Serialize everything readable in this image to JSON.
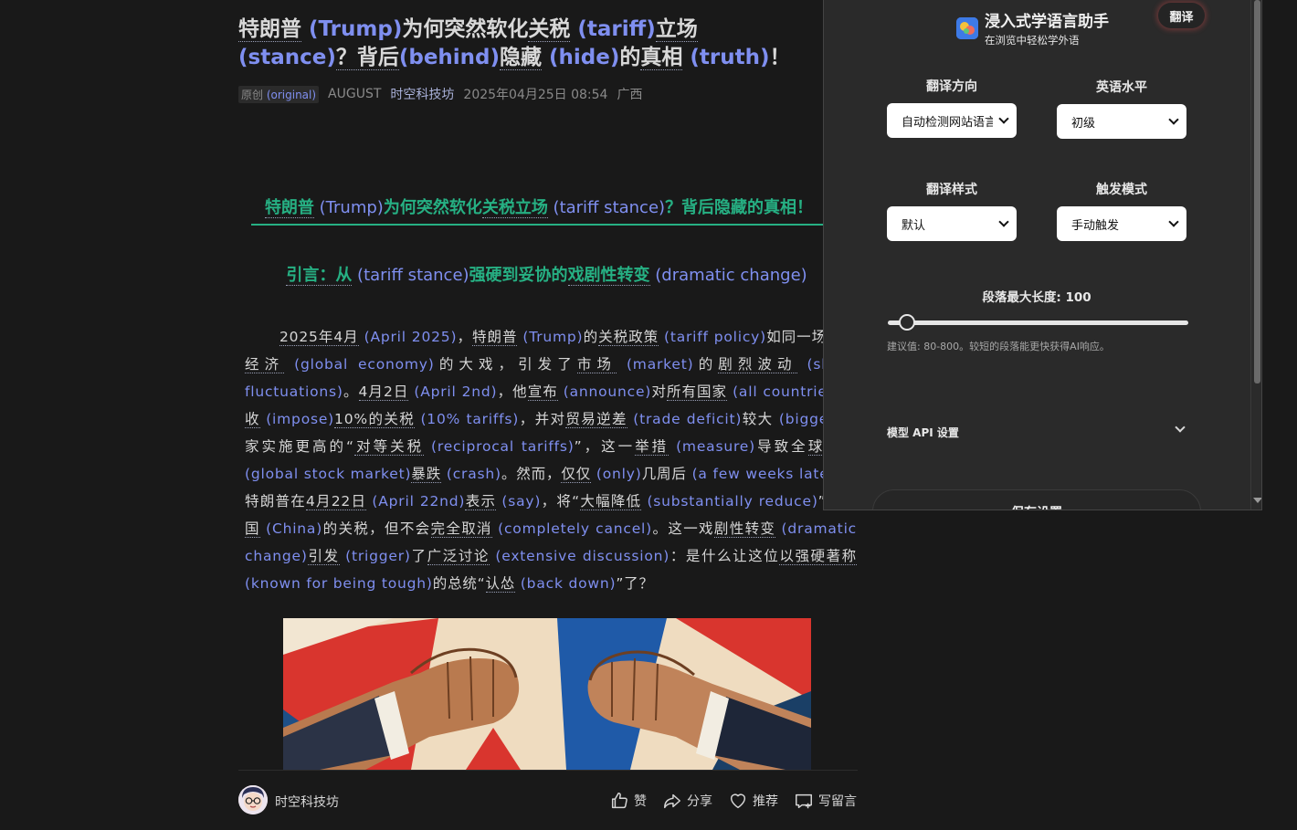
{
  "article": {
    "title": [
      {
        "t": "特朗普",
        "ul": true
      },
      {
        "t": " (Trump)",
        "en": true
      },
      {
        "t": "为何突然软化"
      },
      {
        "t": "关税",
        "ul": true
      },
      {
        "t": " (tariff)",
        "en": true
      },
      {
        "t": "立场",
        "ul": true
      },
      {
        "t": " (stance)",
        "en": true
      },
      {
        "t": "？背后",
        "ul": true
      },
      {
        "t": "(behind)",
        "en": true
      },
      {
        "t": "隐藏",
        "ul": true
      },
      {
        "t": " (hide)",
        "en": true
      },
      {
        "t": "的"
      },
      {
        "t": "真相",
        "ul": true
      },
      {
        "t": " (truth)",
        "en": true
      },
      {
        "t": "！"
      }
    ],
    "meta": {
      "tag_cn": "原创",
      "tag_en": " (original)",
      "author_tag": "AUGUST",
      "account": "时空科技坊",
      "datetime": "2025年04月25日 08:54",
      "location": "广西"
    },
    "heading1": [
      {
        "t": "特朗普",
        "ul": true
      },
      {
        "t": " (Trump)",
        "en": true
      },
      {
        "t": "为何突然软化"
      },
      {
        "t": "关税立场",
        "ul": true
      },
      {
        "t": " (tariff stance)",
        "en": true
      },
      {
        "t": "？背后隐藏的真相！"
      }
    ],
    "heading2": [
      {
        "t": "引言：从",
        "ul": true
      },
      {
        "t": " (tariff stance)",
        "en": true
      },
      {
        "t": "强硬到妥协的"
      },
      {
        "t": "戏剧性转变",
        "ul": true
      },
      {
        "t": " (dramatic change)",
        "en": true
      }
    ],
    "paragraph": [
      {
        "t": "2025年4月",
        "ul": true
      },
      {
        "t": " (April 2025)",
        "en": true
      },
      {
        "t": "，"
      },
      {
        "t": "特朗普",
        "ul": true
      },
      {
        "t": " (Trump)",
        "en": true
      },
      {
        "t": "的"
      },
      {
        "t": "关税政策",
        "ul": true
      },
      {
        "t": " (tariff policy)",
        "en": true
      },
      {
        "t": "如同一场全"
      },
      {
        "t": "球经济",
        "ul": true
      },
      {
        "t": " (global economy)",
        "en": true
      },
      {
        "t": "的大戏，引发了"
      },
      {
        "t": "市场",
        "ul": true
      },
      {
        "t": " (market)",
        "en": true
      },
      {
        "t": "的"
      },
      {
        "t": "剧烈波动",
        "ul": true
      },
      {
        "t": " (sharp fluctuations)",
        "en": true
      },
      {
        "t": "。"
      },
      {
        "t": "4月2日",
        "ul": true
      },
      {
        "t": " (April 2nd)",
        "en": true
      },
      {
        "t": "，他"
      },
      {
        "t": "宣布",
        "ul": true
      },
      {
        "t": " (announce)",
        "en": true
      },
      {
        "t": "对"
      },
      {
        "t": "所有国家",
        "ul": true
      },
      {
        "t": " (all countries)",
        "en": true
      },
      {
        "t": "征收",
        "ul": true
      },
      {
        "t": " (impose)",
        "en": true
      },
      {
        "t": "10%的关税",
        "ul": true
      },
      {
        "t": " (10% tariffs)",
        "en": true
      },
      {
        "t": "，并对"
      },
      {
        "t": "贸易逆差",
        "ul": true
      },
      {
        "t": " (trade deficit)",
        "en": true
      },
      {
        "t": "较大"
      },
      {
        "t": " (bigger)",
        "en": true
      },
      {
        "t": "国家实施更高的“"
      },
      {
        "t": "对等关税",
        "ul": true
      },
      {
        "t": " (reciprocal tariffs)",
        "en": true
      },
      {
        "t": "”，这一"
      },
      {
        "t": "举措",
        "ul": true
      },
      {
        "t": " (measure)",
        "en": true
      },
      {
        "t": "导致全"
      },
      {
        "t": "球股市",
        "ul": true
      },
      {
        "t": " (global stock market)",
        "en": true
      },
      {
        "t": "暴跌",
        "ul": true
      },
      {
        "t": " (crash)",
        "en": true
      },
      {
        "t": "。然而，"
      },
      {
        "t": "仅仅",
        "ul": true
      },
      {
        "t": " (only)",
        "en": true
      },
      {
        "t": "几周后"
      },
      {
        "t": " (a few weeks later)",
        "en": true
      },
      {
        "t": "，特朗普在"
      },
      {
        "t": "4月22日",
        "ul": true
      },
      {
        "t": " (April 22nd)",
        "en": true
      },
      {
        "t": "表示",
        "ul": true
      },
      {
        "t": " (say)",
        "en": true
      },
      {
        "t": "，将“"
      },
      {
        "t": "大幅降低",
        "ul": true
      },
      {
        "t": " (substantially reduce)",
        "en": true
      },
      {
        "t": "”对"
      },
      {
        "t": "中国",
        "ul": true
      },
      {
        "t": " (China)",
        "en": true
      },
      {
        "t": "的关税，但不会"
      },
      {
        "t": "完全取消",
        "ul": true
      },
      {
        "t": " (completely cancel)",
        "en": true
      },
      {
        "t": "。这一戏"
      },
      {
        "t": "剧性转变",
        "ul": true
      },
      {
        "t": " (dramatic change)",
        "en": true
      },
      {
        "t": "引发",
        "ul": true
      },
      {
        "t": " (trigger)",
        "en": true
      },
      {
        "t": "了"
      },
      {
        "t": "广泛讨论",
        "ul": true
      },
      {
        "t": " (extensive discussion)",
        "en": true
      },
      {
        "t": "：是什么让这位"
      },
      {
        "t": "以强硬著称",
        "ul": true
      },
      {
        "t": " (known for being tough)",
        "en": true
      },
      {
        "t": "的总统“"
      },
      {
        "t": "认怂",
        "ul": true
      },
      {
        "t": " (back down)",
        "en": true
      },
      {
        "t": "”了？"
      }
    ]
  },
  "footer": {
    "author": "时空科技坊",
    "like": "赞",
    "share": "分享",
    "recommend": "推荐",
    "comment": "写留言"
  },
  "panel": {
    "title": "浸入式学语言助手",
    "subtitle": "在浏览中轻松学外语",
    "translate_button": "翻译",
    "direction_label": "翻译方向",
    "direction_value": "自动检测网站语言",
    "level_label": "英语水平",
    "level_value": "初级",
    "style_label": "翻译样式",
    "style_value": "默认",
    "trigger_label": "触发模式",
    "trigger_value": "手动触发",
    "max_length_label": "段落最大长度: 100",
    "max_length_value": 100,
    "max_length_min": 80,
    "max_length_max": 800,
    "hint": "建议值: 80-800。较短的段落能更快获得AI响应。",
    "api_label": "模型 API 设置",
    "save_button": "保存设置"
  },
  "colors": {
    "background": "#191919",
    "accent_green": "#26b083",
    "translation_blue": "#7f8ff0",
    "panel_bg": "#2a2a2a"
  }
}
